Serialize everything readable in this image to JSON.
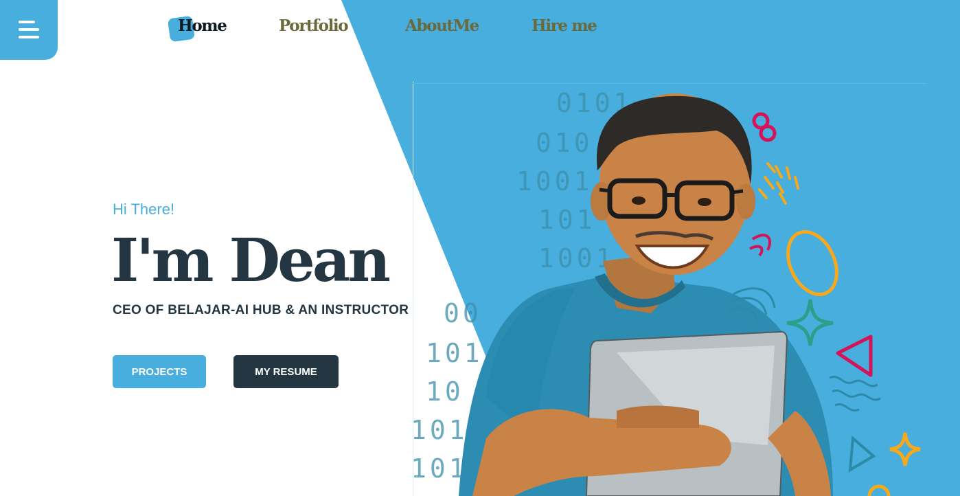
{
  "colors": {
    "accent": "#48aede",
    "dark": "#233642",
    "nav_inactive": "#6b6a3c",
    "nav_active": "#0e1a22"
  },
  "menu": {
    "icon": "hamburger-menu-icon"
  },
  "nav": {
    "home": "Home",
    "portfolio": "Portfolio",
    "about": "AboutMe",
    "hire": "Hire me",
    "active": "Home"
  },
  "hero": {
    "greeting": "Hi There!",
    "name": "I'm Dean",
    "subtitle": "CEO OF BELAJAR-AI HUB & AN INSTRUCTOR",
    "projects_label": "PROJECTS",
    "resume_label": "MY RESUME"
  },
  "portrait": {
    "description_icon": "portrait-illustration",
    "binary": [
      "0101",
      "010",
      "1001",
      "101",
      "1001",
      "00",
      "101",
      "10",
      "101",
      "101"
    ]
  }
}
